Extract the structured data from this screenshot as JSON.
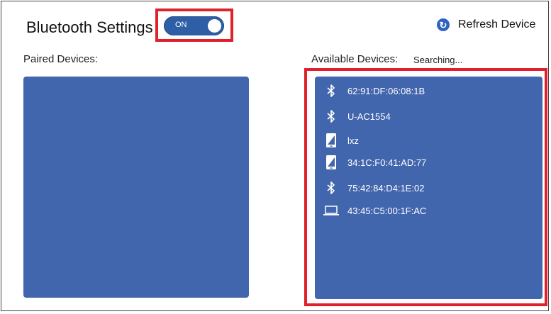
{
  "header": {
    "title": "Bluetooth Settings",
    "toggle": {
      "label": "ON",
      "state": "on"
    },
    "refresh": {
      "label": "Refresh Device",
      "icon": "refresh-icon"
    }
  },
  "paired": {
    "label": "Paired Devices:",
    "devices": []
  },
  "available": {
    "label": "Available Devices:",
    "status": "Searching...",
    "devices": [
      {
        "name": "62:91:DF:06:08:1B",
        "icon": "bluetooth-icon"
      },
      {
        "name": "U-AC1554",
        "icon": "bluetooth-icon"
      },
      {
        "name": "lxz",
        "icon": "phone-icon"
      },
      {
        "name": "34:1C:F0:41:AD:77",
        "icon": "phone-icon"
      },
      {
        "name": "75:42:84:D4:1E:02",
        "icon": "bluetooth-icon"
      },
      {
        "name": "43:45:C5:00:1F:AC",
        "icon": "laptop-icon"
      }
    ]
  },
  "colors": {
    "panel": "#4266ad",
    "toggle": "#2e5fa6",
    "highlight": "#e0202a",
    "refresh_icon": "#2e62c0"
  }
}
